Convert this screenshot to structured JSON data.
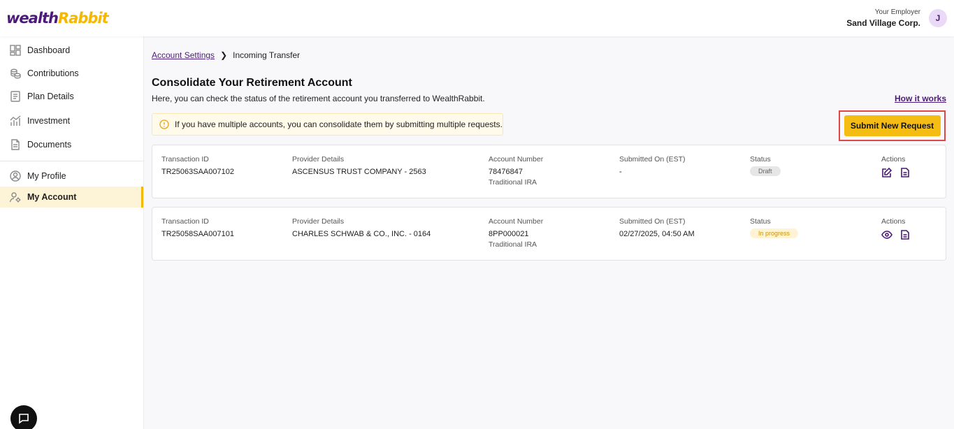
{
  "header": {
    "logo_main": "wealth",
    "logo_accent": "Rabbit",
    "employer_label": "Your Employer",
    "employer_name": "Sand Village Corp.",
    "avatar_initial": "J"
  },
  "sidebar": {
    "items": [
      {
        "label": "Dashboard",
        "icon": "dashboard-icon"
      },
      {
        "label": "Contributions",
        "icon": "coins-icon"
      },
      {
        "label": "Plan Details",
        "icon": "document-list-icon"
      },
      {
        "label": "Investment",
        "icon": "chart-icon"
      },
      {
        "label": "Documents",
        "icon": "file-icon"
      },
      {
        "label": "My Profile",
        "icon": "user-circle-icon"
      },
      {
        "label": "My Account",
        "icon": "user-settings-icon",
        "active": true
      }
    ]
  },
  "breadcrumb": {
    "parent": "Account Settings",
    "current": "Incoming Transfer"
  },
  "page": {
    "title": "Consolidate Your Retirement Account",
    "description": "Here, you can check the status of the retirement account you transferred to WealthRabbit.",
    "how_it_works": "How it works",
    "notice": "If you have multiple accounts, you can consolidate them by submitting multiple requests.",
    "submit_button": "Submit New Request"
  },
  "columns": {
    "transaction_id": "Transaction ID",
    "provider": "Provider Details",
    "account_number": "Account Number",
    "submitted_on": "Submitted On (EST)",
    "status": "Status",
    "actions": "Actions"
  },
  "transfers": [
    {
      "transaction_id": "TR25063SAA007102",
      "provider": "ASCENSUS TRUST COMPANY - 2563",
      "account_number": "78476847",
      "account_type": "Traditional IRA",
      "submitted_on": "-",
      "status": "Draft",
      "actions": [
        "edit-icon",
        "document-icon"
      ]
    },
    {
      "transaction_id": "TR25058SAA007101",
      "provider": "CHARLES SCHWAB & CO., INC. - 0164",
      "account_number": "8PP000021",
      "account_type": "Traditional IRA",
      "submitted_on": "02/27/2025, 04:50 AM",
      "status": "In progress",
      "actions": [
        "eye-icon",
        "document-icon"
      ]
    }
  ],
  "colors": {
    "brand_purple": "#4b1a7a",
    "brand_yellow": "#f5bd14",
    "highlight_red": "#e04848"
  }
}
